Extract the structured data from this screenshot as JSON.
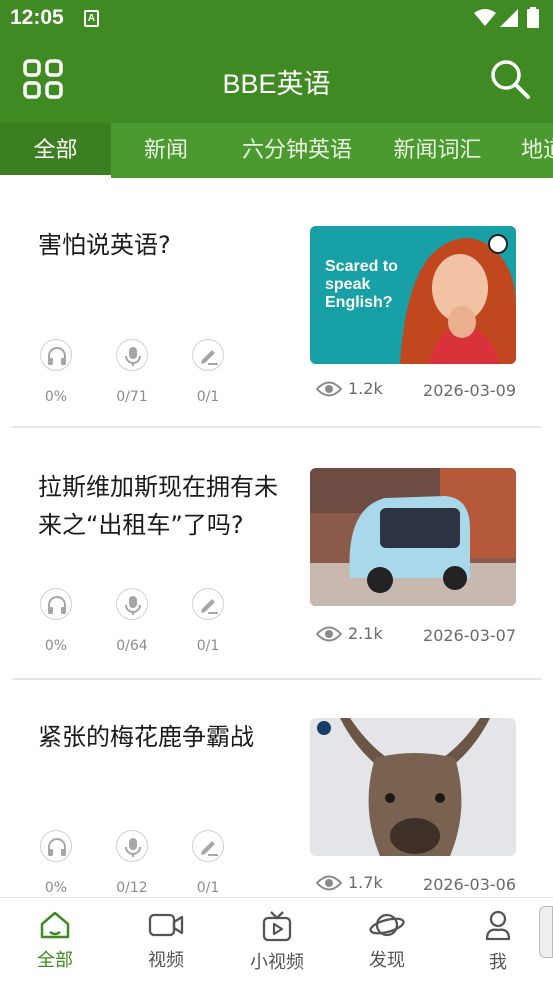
{
  "status_bar": {
    "time": "12:05",
    "notification_glyph": "A"
  },
  "app_bar": {
    "title": "BBE英语",
    "menu_icon": "grid-icon",
    "search_icon": "search-icon"
  },
  "tabs": [
    {
      "label": "全部",
      "active": true
    },
    {
      "label": "新闻",
      "active": false
    },
    {
      "label": "六分钟英语",
      "active": false
    },
    {
      "label": "新闻词汇",
      "active": false
    },
    {
      "label": "地道",
      "active": false
    }
  ],
  "articles": [
    {
      "title": "害怕说英语?",
      "listen": "0%",
      "speak": "0/71",
      "write": "0/1",
      "thumb_text": "Scared to speak English?",
      "views": "1.2k",
      "date": "2026-03-09"
    },
    {
      "title": "拉斯维加斯现在拥有未来之“出租车”了吗?",
      "listen": "0%",
      "speak": "0/64",
      "write": "0/1",
      "views": "2.1k",
      "date": "2026-03-07"
    },
    {
      "title": "紧张的梅花鹿争霸战",
      "listen": "0%",
      "speak": "0/12",
      "write": "0/1",
      "views": "1.7k",
      "date": "2026-03-06"
    }
  ],
  "bottom_nav": [
    {
      "label": "全部",
      "icon": "home-icon",
      "active": true
    },
    {
      "label": "视频",
      "icon": "video-camera-icon",
      "active": false
    },
    {
      "label": "小视频",
      "icon": "tv-play-icon",
      "active": false
    },
    {
      "label": "发现",
      "icon": "planet-icon",
      "active": false
    },
    {
      "label": "我",
      "icon": "person-icon",
      "active": false
    }
  ],
  "colors": {
    "primary": "#3f8a22",
    "tab_bar": "#4b9a2f",
    "active_tab": "#3b7f20",
    "muted_text": "#8c8c8c"
  }
}
